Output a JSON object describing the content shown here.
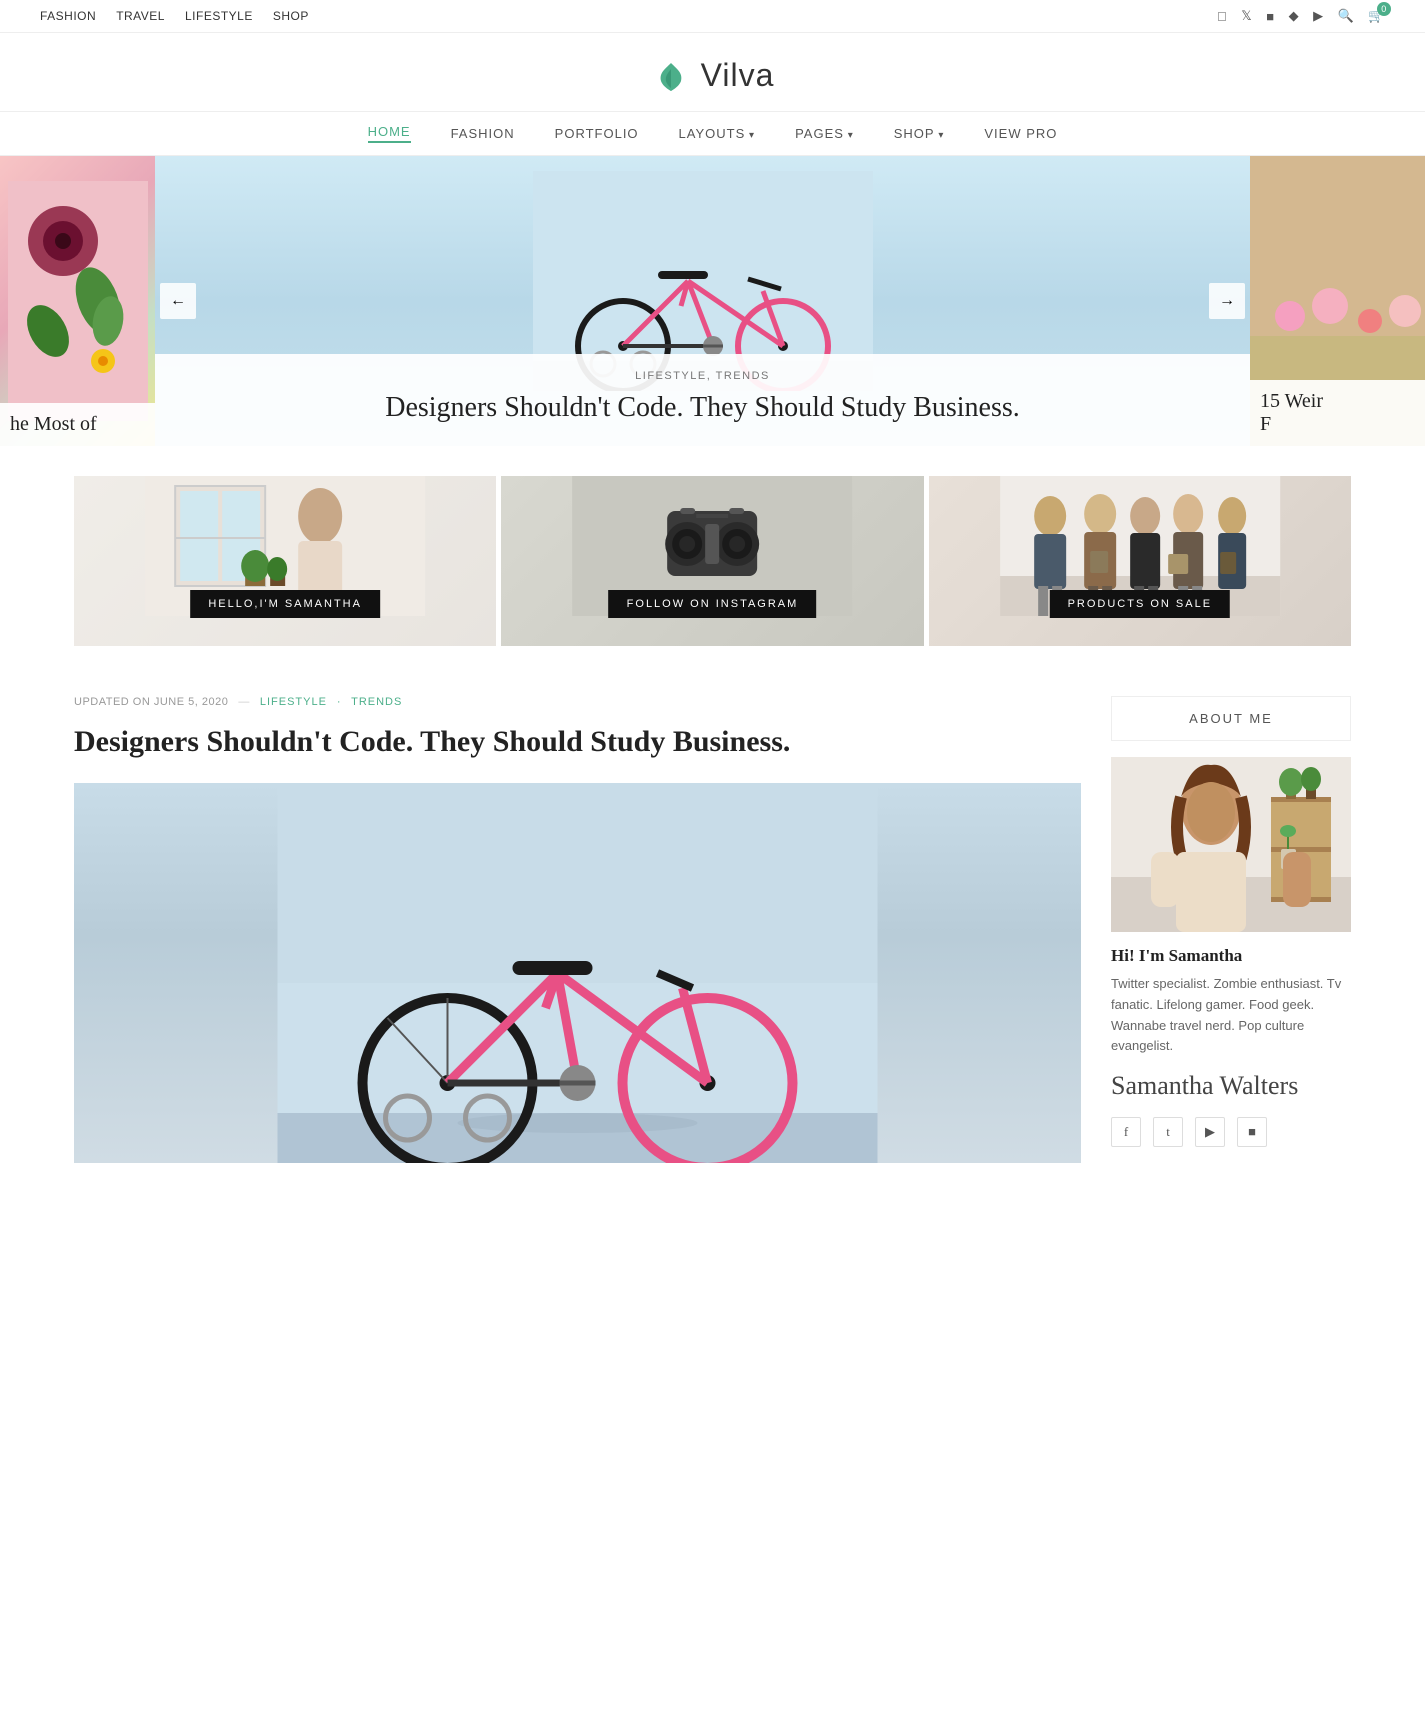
{
  "topbar": {
    "nav_items": [
      "FASHION",
      "TRAVEL",
      "LIFESTYLE",
      "SHOP"
    ],
    "cart_count": "0"
  },
  "logo": {
    "text": "Vilva"
  },
  "main_nav": {
    "items": [
      {
        "label": "HOME",
        "active": true,
        "has_arrow": false
      },
      {
        "label": "FASHION",
        "active": false,
        "has_arrow": false
      },
      {
        "label": "PORTFOLIO",
        "active": false,
        "has_arrow": false
      },
      {
        "label": "LAYOUTS",
        "active": false,
        "has_arrow": true
      },
      {
        "label": "PAGES",
        "active": false,
        "has_arrow": true
      },
      {
        "label": "SHOP",
        "active": false,
        "has_arrow": true
      },
      {
        "label": "VIEW PRO",
        "active": false,
        "has_arrow": false
      }
    ]
  },
  "hero": {
    "tags": "LIFESTYLE,  TRENDS",
    "title": "Designers Shouldn't Code. They Should Study Business.",
    "left_partial": "he Most of",
    "right_partial": "15 Weir",
    "right_partial2": "F"
  },
  "promo": {
    "boxes": [
      {
        "label": "HELLO,I'M SAMANTHA"
      },
      {
        "label": "FOLLOW ON INSTAGRAM"
      },
      {
        "label": "PRODUCTS ON SALE"
      }
    ]
  },
  "article": {
    "updated_label": "UPDATED ON JUNE 5, 2020",
    "category": "LIFESTYLE",
    "dot": "·",
    "subcategory": "TRENDS",
    "title": "Designers Shouldn't Code. They Should Study Business."
  },
  "sidebar": {
    "about_title": "ABOUT ME",
    "about_name": "Hi! I'm Samantha",
    "about_bio": "Twitter specialist. Zombie enthusiast. Tv fanatic. Lifelong gamer. Food geek. Wannabe travel nerd. Pop culture evangelist.",
    "about_signature": "Samantha Walters",
    "social_icons": [
      "f",
      "t",
      "▶",
      "📷"
    ]
  }
}
